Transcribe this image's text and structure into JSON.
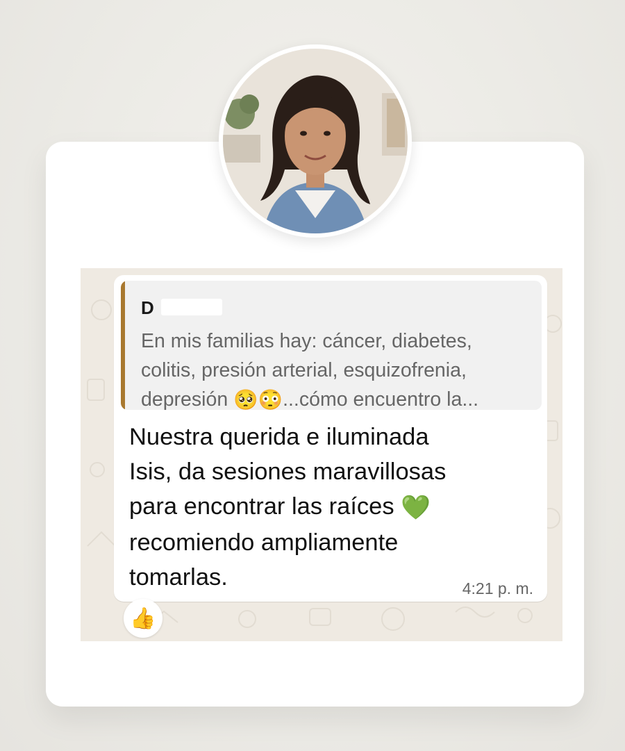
{
  "quote": {
    "author": "D",
    "text_before_emoji": "En mis familias hay: cáncer, diabetes, colitis, presión arterial, esquizofrenia, depresión ",
    "emoji_1": "🥺",
    "emoji_2": "😳",
    "text_after_emoji": "...cómo encuentro la..."
  },
  "message": {
    "line_1": "Nuestra querida e iluminada",
    "line_2": "Isis, da sesiones maravillosas",
    "line_3": "para encontrar las raíces ",
    "heart_emoji": "💚",
    "line_4": "recomiendo ampliamente",
    "line_5": "tomarlas.",
    "time": "4:21 p. m."
  },
  "reaction": {
    "emoji": "👍"
  },
  "colors": {
    "quote_bar": "#a8782f",
    "chat_background": "#efeae2",
    "bubble": "#ffffff"
  }
}
